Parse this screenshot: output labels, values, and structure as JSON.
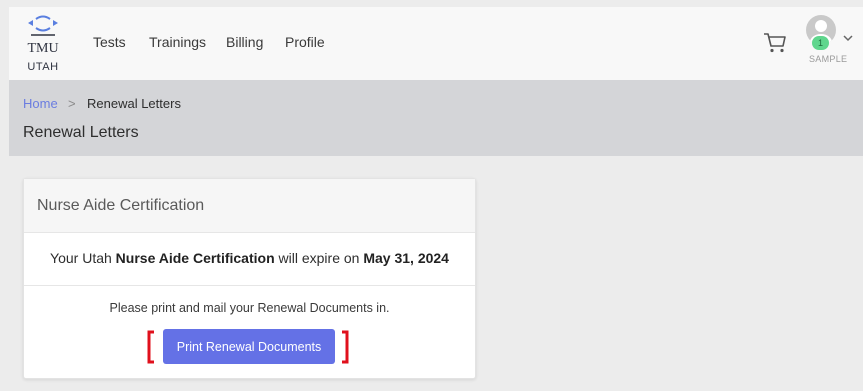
{
  "brand": {
    "name": "TMU",
    "state": "UTAH"
  },
  "nav": {
    "items": [
      {
        "label": "Tests"
      },
      {
        "label": "Trainings"
      },
      {
        "label": "Billing"
      },
      {
        "label": "Profile"
      }
    ]
  },
  "user": {
    "cart_icon": "cart-icon",
    "avatar_icon": "user-avatar-icon",
    "badge_count": "1",
    "label": "SAMPLE",
    "menu_icon": "chevron-down-icon"
  },
  "breadcrumb": {
    "home": "Home",
    "separator": ">",
    "current": "Renewal Letters"
  },
  "page": {
    "title": "Renewal Letters"
  },
  "card": {
    "title": "Nurse Aide Certification",
    "expire_prefix": "Your Utah ",
    "expire_cert": "Nurse Aide Certification",
    "expire_middle": " will expire on ",
    "expire_date": "May 31, 2024",
    "instruction": "Please print and mail your Renewal Documents in.",
    "button_label": "Print Renewal Documents"
  },
  "colors": {
    "accent": "#6471e6",
    "link": "#6b7de0",
    "highlight_bracket": "#e0101c",
    "badge": "#5fd68d",
    "header_band": "#d4d5d8"
  }
}
